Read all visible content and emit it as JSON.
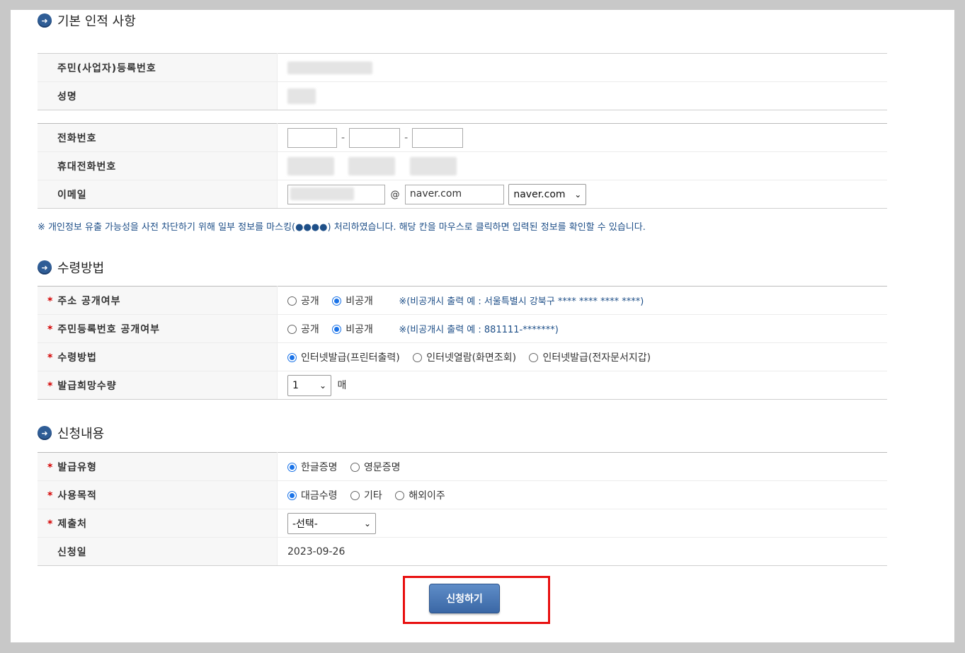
{
  "sections": {
    "basic": {
      "title": "기본 인적 사항"
    },
    "receive": {
      "title": "수령방법"
    },
    "request": {
      "title": "신청내용"
    }
  },
  "basic": {
    "id_label": "주민(사업자)등록번호",
    "name_label": "성명"
  },
  "contact": {
    "phone_label": "전화번호",
    "mobile_label": "휴대전화번호",
    "email_label": "이메일",
    "at_sign": "@",
    "email_domain_value": "naver.com",
    "email_domain_select": "naver.com",
    "dash": "-"
  },
  "notice": "※ 개인정보 유출 가능성을 사전 차단하기 위해 일부 정보를 마스킹(●●●●) 처리하였습니다. 해당 칸을 마우스로 클릭하면 입력된 정보를 확인할 수 있습니다.",
  "receive": {
    "address_label": "주소 공개여부",
    "rrn_label": "주민등록번호 공개여부",
    "method_label": "수령방법",
    "qty_label": "발급희망수량",
    "opt_public": "공개",
    "opt_private": "비공개",
    "address_note": "※(비공개시 출력 예 : 서울특별시 강북구 **** **** **** ****)",
    "rrn_note": "※(비공개시 출력 예 : 881111-*******)",
    "method_opt1": "인터넷발급(프린터출력)",
    "method_opt2": "인터넷열람(화면조회)",
    "method_opt3": "인터넷발급(전자문서지갑)",
    "qty_value": "1",
    "qty_unit": "매"
  },
  "request": {
    "type_label": "발급유형",
    "type_opt1": "한글증명",
    "type_opt2": "영문증명",
    "purpose_label": "사용목적",
    "purpose_opt1": "대금수령",
    "purpose_opt2": "기타",
    "purpose_opt3": "해외이주",
    "submit_to_label": "제출처",
    "submit_to_value": "-선택-",
    "date_label": "신청일",
    "date_value": "2023-09-26"
  },
  "required_mark": "*",
  "submit_label": "신청하기",
  "colors": {
    "accent": "#3a67a5",
    "highlight_border": "#e81010",
    "note_text": "#1e4f88",
    "required": "#d40000"
  }
}
